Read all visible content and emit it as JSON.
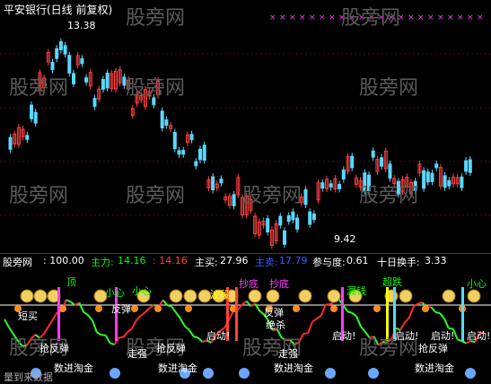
{
  "window_title": "平安银行(日线 前复权)",
  "price_high_label": "13.38",
  "price_low_label": "9.42",
  "watermark": "股旁网",
  "indicator_bar": {
    "name": "股旁网",
    "value1": ": 100.00",
    "zhuli_label": "主力: ",
    "zhuli_value": "14.16",
    "val_red": ": 14.16",
    "zhumai_label": "主买: ",
    "zhumai_value": "27.96",
    "zhumai2_label": "主卖: ",
    "zhumai2_value": "17.79",
    "canyu_label": "参与度: ",
    "canyu_value": "0.61",
    "huanshou_label": "十日换手: ",
    "huanshou_value": "3.33"
  },
  "signals": {
    "ding": "顶",
    "xiaoxin": "小心",
    "chaodi": "抄底",
    "boduan": "波段",
    "loudian": "漏钱",
    "chaofei": "超跌",
    "duanmai": "短买",
    "fantan": "反弹",
    "qidong": "启动!",
    "zouqiang": "走强",
    "juesha": "绝杀",
    "shujinjin": "数进淘金",
    "qiaodan": "抢反弹",
    "bottom_text": "量到来数据"
  },
  "colors": {
    "background": "#000000",
    "up": "#ff4040",
    "down": "#5ad8ff",
    "magenta": "#ff3cff",
    "yellow": "#ffff00",
    "green": "#00ff00",
    "white": "#ffffff"
  }
}
